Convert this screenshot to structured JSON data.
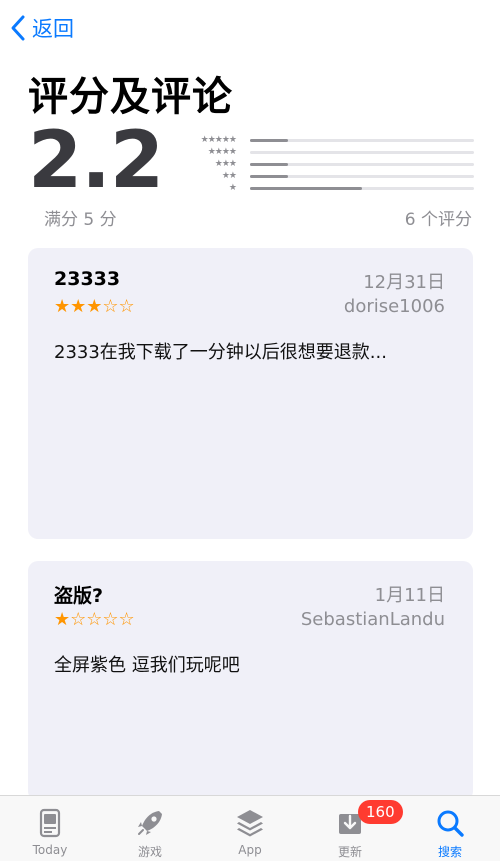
{
  "nav": {
    "back_label": "返回"
  },
  "page": {
    "title": "评分及评论"
  },
  "rating": {
    "score": "2.2",
    "out_of": "满分 5 分",
    "count": "6 个评分",
    "histogram": [
      {
        "stars": "★★★★★",
        "fraction": 0.17
      },
      {
        "stars": "★★★★",
        "fraction": 0.0
      },
      {
        "stars": "★★★",
        "fraction": 0.17
      },
      {
        "stars": "★★",
        "fraction": 0.17
      },
      {
        "stars": "★",
        "fraction": 0.5
      }
    ]
  },
  "reviews": [
    {
      "title": "23333",
      "date": "12月31日",
      "stars": "★★★☆☆",
      "author": "dorise1006",
      "body": "2333在我下载了一分钟以后很想要退款..."
    },
    {
      "title": "盗版?",
      "date": "1月11日",
      "stars": "★☆☆☆☆",
      "author": "SebastianLandu",
      "body": "全屏紫色 逗我们玩呢吧"
    }
  ],
  "tabbar": {
    "today": "Today",
    "games": "游戏",
    "apps": "App",
    "updates": "更新",
    "updates_badge": "160",
    "search": "搜索",
    "active_color": "#0a7aff",
    "inactive_color": "#8e8e93"
  }
}
